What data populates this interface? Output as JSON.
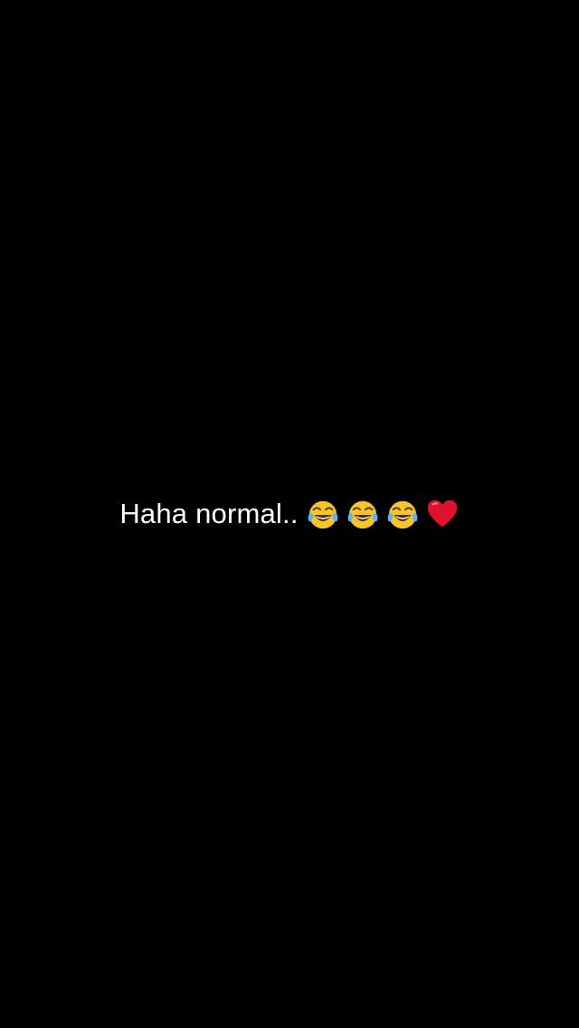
{
  "caption": {
    "text": "Haha normal..",
    "emojis": [
      "face-with-tears-of-joy-icon",
      "face-with-tears-of-joy-icon",
      "face-with-tears-of-joy-icon",
      "red-heart-icon"
    ]
  },
  "colors": {
    "background": "#000000",
    "text": "#ffffff",
    "emoji_face": "#f7c42c",
    "emoji_tears": "#5db7f0",
    "heart": "#e0112b"
  }
}
